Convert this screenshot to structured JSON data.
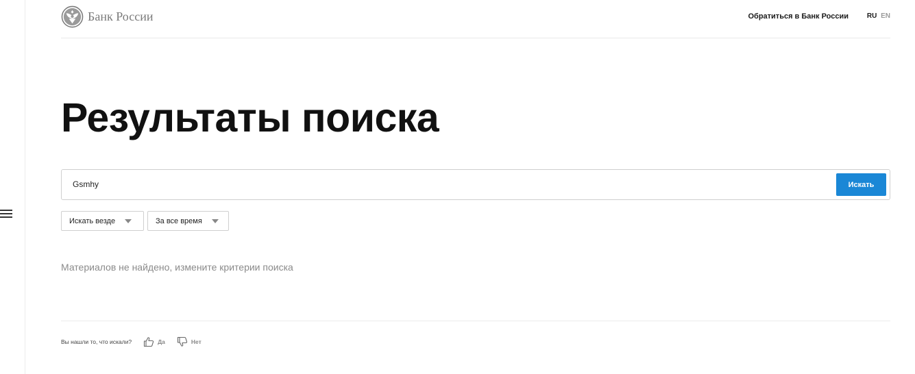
{
  "header": {
    "logo_text": "Банк России",
    "contact_link": "Обратиться в Банк России",
    "lang_ru": "RU",
    "lang_en": "EN"
  },
  "main": {
    "title": "Результаты поиска",
    "search": {
      "value": "Gsmhy",
      "button_label": "Искать"
    },
    "filters": [
      {
        "label": "Искать везде"
      },
      {
        "label": "За все время"
      }
    ],
    "empty_message": "Материалов не найдено, измените критерии поиска"
  },
  "feedback": {
    "question": "Вы нашли то, что искали?",
    "yes_label": "Да",
    "no_label": "Нет"
  },
  "icons": {
    "menu": "hamburger-menu-icon",
    "logo": "double-eagle-emblem-icon",
    "filter_arrow": "chevron-down-icon",
    "yes": "thumbs-up-icon",
    "no": "thumbs-down-icon"
  },
  "colors": {
    "accent": "#1a87d6",
    "muted_text": "#8a8a8a",
    "border": "#cfcfcf"
  }
}
